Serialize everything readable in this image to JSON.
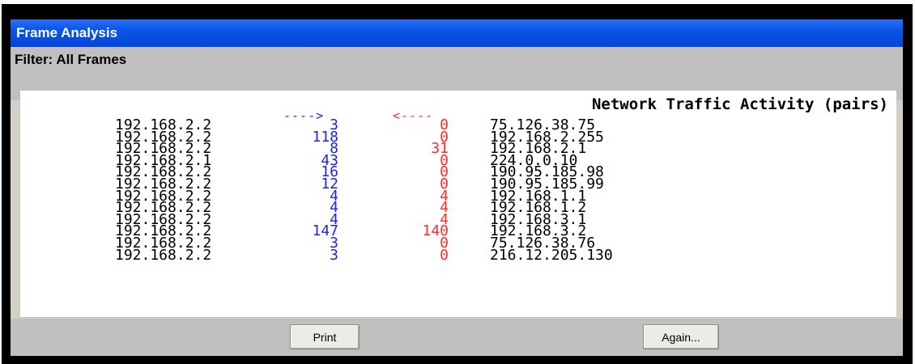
{
  "window": {
    "title": "Frame Analysis",
    "filter_label": "Filter: All Frames"
  },
  "chart": {
    "title": "Network Traffic Activity (pairs)",
    "arrow_out": "---->",
    "arrow_in": "<----",
    "colors": {
      "out": "#1a27e0",
      "in": "#ff2a2a"
    }
  },
  "rows": [
    {
      "src": "192.168.2.2",
      "out": "3",
      "in": "0",
      "dst": "75.126.38.75"
    },
    {
      "src": "192.168.2.2",
      "out": "118",
      "in": "0",
      "dst": "192.168.2.255"
    },
    {
      "src": "192.168.2.2",
      "out": "8",
      "in": "31",
      "dst": "192.168.2.1"
    },
    {
      "src": "192.168.2.1",
      "out": "43",
      "in": "0",
      "dst": "224.0.0.10"
    },
    {
      "src": "192.168.2.2",
      "out": "16",
      "in": "0",
      "dst": "190.95.185.98"
    },
    {
      "src": "192.168.2.2",
      "out": "12",
      "in": "0",
      "dst": "190.95.185.99"
    },
    {
      "src": "192.168.2.2",
      "out": "4",
      "in": "4",
      "dst": "192.168.1.1"
    },
    {
      "src": "192.168.2.2",
      "out": "4",
      "in": "4",
      "dst": "192.168.1.2"
    },
    {
      "src": "192.168.2.2",
      "out": "4",
      "in": "4",
      "dst": "192.168.3.1"
    },
    {
      "src": "192.168.2.2",
      "out": "147",
      "in": "140",
      "dst": "192.168.3.2"
    },
    {
      "src": "192.168.2.2",
      "out": "3",
      "in": "0",
      "dst": "75.126.38.76"
    },
    {
      "src": "192.168.2.2",
      "out": "3",
      "in": "0",
      "dst": "216.12.205.130"
    }
  ],
  "buttons": {
    "print": "Print",
    "again": "Again..."
  }
}
